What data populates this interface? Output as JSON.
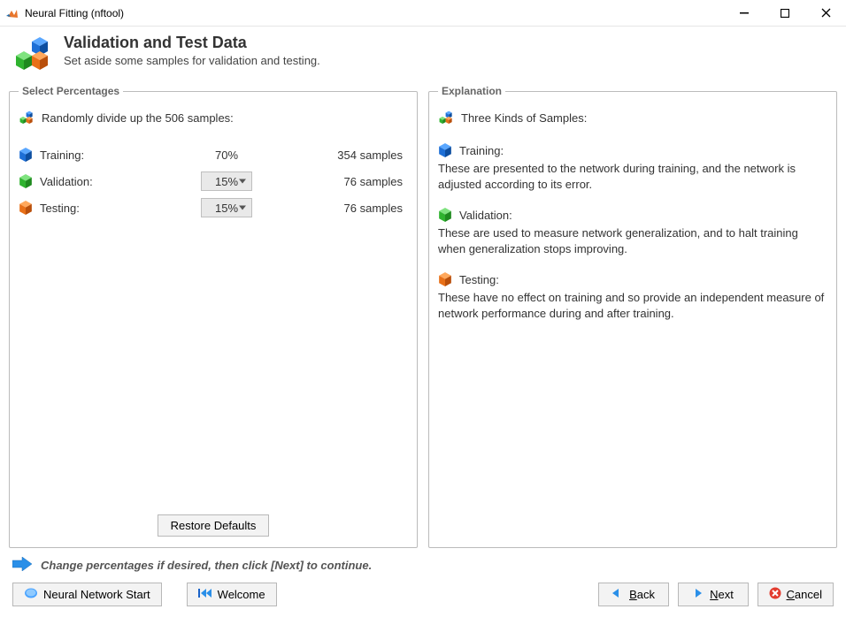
{
  "window": {
    "title": "Neural Fitting (nftool)"
  },
  "header": {
    "title": "Validation and Test Data",
    "subtitle": "Set aside some samples for validation and testing."
  },
  "leftPanel": {
    "legend": "Select Percentages",
    "intro": "Randomly divide up the 506 samples:",
    "rows": {
      "training": {
        "label": "Training:",
        "percent": "70%",
        "samples": "354 samples"
      },
      "validation": {
        "label": "Validation:",
        "percent": "15%",
        "samples": "76 samples"
      },
      "testing": {
        "label": "Testing:",
        "percent": "15%",
        "samples": "76 samples"
      }
    },
    "restore": "Restore Defaults"
  },
  "rightPanel": {
    "legend": "Explanation",
    "intro": "Three Kinds of Samples:",
    "training": {
      "label": "Training:",
      "text": "These are presented to the network during training, and the network is adjusted according to its error."
    },
    "validation": {
      "label": "Validation:",
      "text": "These are used to measure network generalization, and to halt training when generalization stops improving."
    },
    "testing": {
      "label": "Testing:",
      "text": "These have no effect on training and so provide an independent measure of network performance during and after training."
    }
  },
  "instruction": "Change percentages if desired, then click [Next] to continue.",
  "footer": {
    "neuralStart": "Neural Network Start",
    "welcome": "Welcome",
    "back": "Back",
    "next": "Next",
    "cancel": "Cancel"
  }
}
